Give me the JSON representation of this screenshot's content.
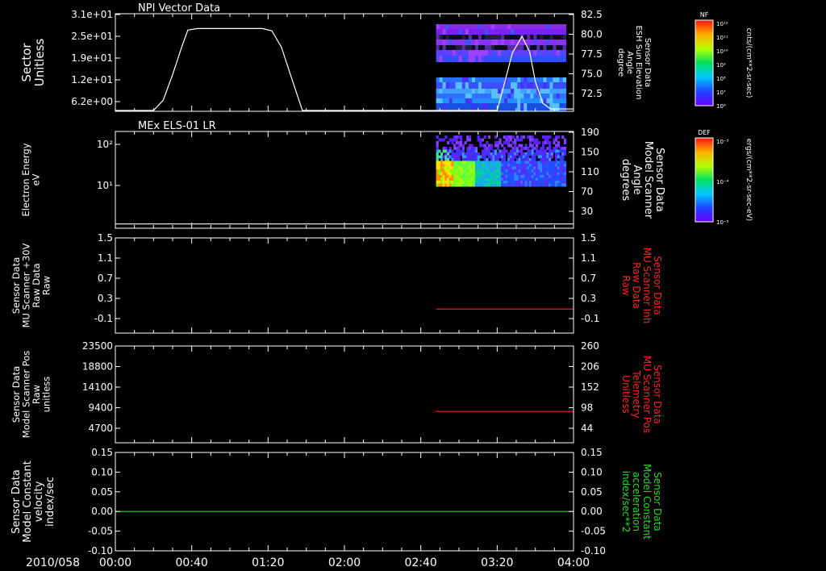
{
  "figure": {
    "date_label": "2010/058",
    "time_ticks": [
      "00:00",
      "00:40",
      "01:20",
      "02:00",
      "02:40",
      "03:20",
      "04:00"
    ]
  },
  "colorbars": [
    {
      "label": "NF",
      "unit": "cnts/(cm**2-sr-sec)",
      "tick_labels": [
        "10¹²",
        "10¹¹",
        "10¹⁰",
        "10⁹",
        "10⁸",
        "10⁷",
        "10⁶"
      ]
    },
    {
      "label": "DEF",
      "unit": "ergs/(cm**2-sr-sec-eV)",
      "tick_labels": [
        "10⁻³",
        "10⁻⁴",
        "10⁻⁵"
      ]
    }
  ],
  "chart_data": [
    {
      "type": "line",
      "title": "NPI Vector Data",
      "ylabel_lines": [
        "Sector",
        "Unitless"
      ],
      "yticks": [
        "3.1e+01",
        "2.5e+01",
        "1.9e+01",
        "1.2e+01",
        "6.2e+00"
      ],
      "ylim": [
        0,
        31
      ],
      "y2label_lines": [
        "Sensor Data",
        "ESH Sun Elevation",
        "Angle",
        "degree"
      ],
      "y2ticks": [
        "82.5",
        "80.0",
        "77.5",
        "75.0",
        "72.5"
      ],
      "y2lim": [
        70,
        82.5
      ],
      "xlim_minutes": [
        0,
        240
      ],
      "series": [
        {
          "axis": "y2",
          "color": "#ffffff",
          "x_minutes": [
            0,
            20,
            25,
            30,
            35,
            38,
            43,
            60,
            77,
            82,
            87,
            92,
            98,
            200,
            203,
            208,
            213,
            217,
            220,
            224,
            228,
            232,
            236,
            240
          ],
          "y": [
            70.1,
            70.1,
            71.4,
            74.7,
            78.4,
            80.4,
            80.6,
            80.6,
            80.6,
            80.3,
            78.2,
            74.5,
            70.1,
            70.1,
            72.8,
            77.5,
            79.6,
            77.6,
            73.8,
            71,
            70.3,
            70.3,
            70.3,
            70.3
          ]
        }
      ],
      "spectrogram": {
        "x_start_minutes": 168,
        "x_end_minutes": 236,
        "channel": "NF"
      }
    },
    {
      "type": "line",
      "title": "MEx ELS-01 LR",
      "ylabel_lines": [
        "Electron Energy",
        "eV"
      ],
      "yticks": [
        "10²",
        "10¹"
      ],
      "y_scale": "log",
      "ylim": [
        1,
        300
      ],
      "y2label_lines": [
        "Sensor Data",
        "Model Scanner",
        "Angle",
        "degrees"
      ],
      "y2ticks": [
        "190",
        "150",
        "110",
        "70",
        "30"
      ],
      "y2lim": [
        10,
        190
      ],
      "xlim_minutes": [
        0,
        240
      ],
      "series": [
        {
          "axis": "y2",
          "color": "#ffffff",
          "x_minutes": [
            0,
            240
          ],
          "y": [
            18,
            18
          ]
        }
      ],
      "spectrogram": {
        "x_start_minutes": 168,
        "x_end_minutes": 236,
        "channel": "DEF"
      }
    },
    {
      "type": "line",
      "ylabel_lines": [
        "Sensor Data",
        "MU Scanner +30V",
        "Raw Data",
        "Raw"
      ],
      "yticks": [
        "1.5",
        "1.1",
        "0.7",
        "0.3",
        "-0.1"
      ],
      "ylim": [
        -0.4,
        1.5
      ],
      "y2label_lines": [
        "Sensor Data",
        "MU Scanner Inh",
        "Raw Data",
        "Raw"
      ],
      "y2ticks": [
        "1.5",
        "1.1",
        "0.7",
        "0.3",
        "-0.1"
      ],
      "y2lim": [
        -0.4,
        1.5
      ],
      "xlim_minutes": [
        0,
        240
      ],
      "series": [
        {
          "axis": "y2",
          "color": "#ff2020",
          "x_minutes": [
            168,
            240
          ],
          "y": [
            0.08,
            0.08
          ]
        }
      ]
    },
    {
      "type": "line",
      "ylabel_lines": [
        "Sensor Data",
        "Model Scanner Pos",
        "Raw",
        "unitless"
      ],
      "yticks": [
        "23500",
        "18800",
        "14100",
        "9400",
        "4700"
      ],
      "ylim": [
        0,
        23500
      ],
      "y2label_lines": [
        "Sensor Data",
        "MU Scanner Pos",
        "Telemetry",
        "Unitless"
      ],
      "y2ticks": [
        "260",
        "206",
        "152",
        "98",
        "44"
      ],
      "y2lim": [
        0,
        260
      ],
      "xlim_minutes": [
        0,
        240
      ],
      "series": [
        {
          "axis": "y2",
          "color": "#ff2020",
          "x_minutes": [
            168,
            240
          ],
          "y": [
            84,
            84
          ]
        }
      ]
    },
    {
      "type": "line",
      "ylabel_lines": [
        "Sensor Data",
        "Model Constant",
        "velocity",
        "index/sec"
      ],
      "yticks": [
        "0.15",
        "0.10",
        "0.05",
        "0.00",
        "-0.05",
        "-0.10"
      ],
      "ylim": [
        -0.1,
        0.15
      ],
      "y2label_lines": [
        "Sensor Data",
        "Model Constant",
        "acceleration",
        "index/sec**2"
      ],
      "y2ticks": [
        "0.15",
        "0.10",
        "0.05",
        "0.00",
        "-0.05",
        "-0.10"
      ],
      "y2lim": [
        -0.1,
        0.15
      ],
      "xlim_minutes": [
        0,
        240
      ],
      "series": [
        {
          "axis": "y2",
          "color": "#22dd22",
          "x_minutes": [
            0,
            240
          ],
          "y": [
            0,
            0
          ]
        }
      ]
    }
  ]
}
